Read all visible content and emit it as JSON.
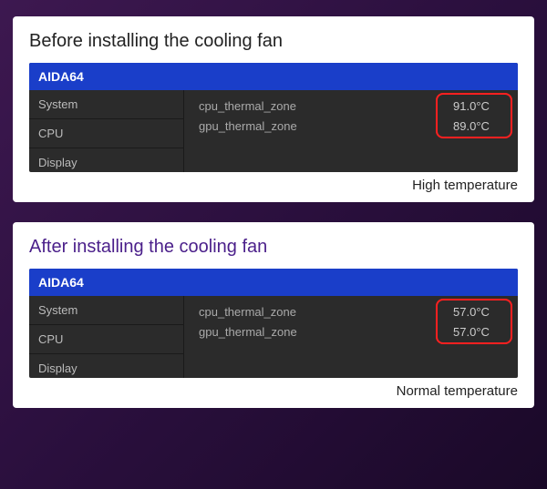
{
  "before": {
    "title": "Before installing the cooling fan",
    "app_name": "AIDA64",
    "sidebar": [
      "System",
      "CPU",
      "Display"
    ],
    "readings": [
      {
        "label": "cpu_thermal_zone",
        "value": "91.0°C"
      },
      {
        "label": "gpu_thermal_zone",
        "value": "89.0°C"
      }
    ],
    "caption": "High temperature"
  },
  "after": {
    "title": "After installing the cooling fan",
    "app_name": "AIDA64",
    "sidebar": [
      "System",
      "CPU",
      "Display"
    ],
    "readings": [
      {
        "label": "cpu_thermal_zone",
        "value": "57.0°C"
      },
      {
        "label": "gpu_thermal_zone",
        "value": "57.0°C"
      }
    ],
    "caption": "Normal temperature"
  }
}
